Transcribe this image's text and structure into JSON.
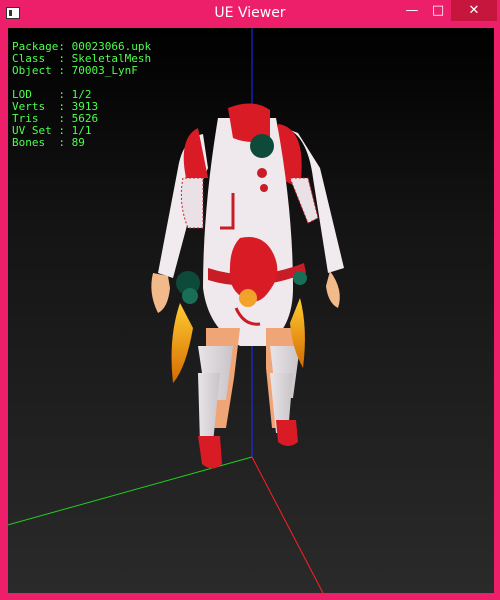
{
  "window": {
    "title": "UE Viewer",
    "controls": {
      "minimize": "—",
      "maximize": "□",
      "close": "✕"
    }
  },
  "info": {
    "package": "Package: 00023066.upk",
    "class": "Class  : SkeletalMesh",
    "object": "Object : 70003_LynF",
    "lod": "LOD    : 1/2",
    "verts": "Verts  : 3913",
    "tris": "Tris   : 5626",
    "uvset": "UV Set : 1/1",
    "bones": "Bones  : 89"
  },
  "colors": {
    "window_frame": "#ee1f6a",
    "close_button": "#c7163e",
    "info_text": "#4cff4c",
    "axis_x": "#ff2020",
    "axis_y": "#20d020",
    "axis_z": "#1e2cff"
  },
  "icons": {
    "app": "app-window-icon"
  }
}
